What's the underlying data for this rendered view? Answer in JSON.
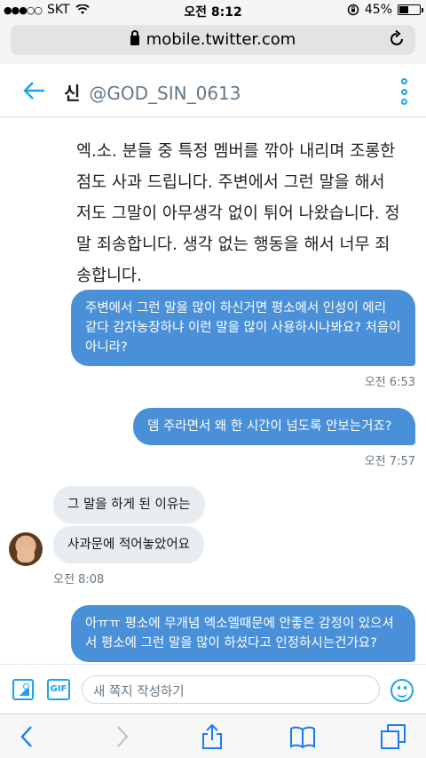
{
  "status_bar": {
    "signal_dots": "●●●○○",
    "carrier": "SKT",
    "time": "오전 8:12",
    "battery_percent": "45%",
    "battery_level": 0.45
  },
  "browser": {
    "url": "mobile.twitter.com"
  },
  "header": {
    "name": "신",
    "handle": "@GOD_SIN_0613",
    "accent": "#1da1f2"
  },
  "conversation": {
    "image_text": "엑.소. 분들 중 특정 멤버를 깎아 내리며 조롱한 점도 사과 드립니다. 주변에서 그런 말을 해서 저도 그말이 아무생각 없이 튀어 나왔습니다. 정말 죄송합니다. 생각 없는 행동을 해서 너무 죄송합니다.",
    "messages": [
      {
        "text": "주변에서 그런 말을 많이 하신거면 평소에서 인성이 에리 같다 감자농장하냐 이런 말을 많이 사용하시나봐요? 처음이 아니라?",
        "time": "오전 6:53"
      },
      {
        "text": "뎀 주라면서 왜 한 시간이 넘도록 안보는거죠?",
        "time": "오전 7:57"
      },
      {
        "text": "그 말을 하게 된 이유는"
      },
      {
        "text": "사과문에 적어놓았어요",
        "time": "오전 8:08"
      },
      {
        "text": "아ㅠㅠ 평소에 무개념 엑소엘때문에 안좋은 감정이 있으셔서 평소에 그런 말을 많이 하셨다고 인정하시는건가요?"
      }
    ]
  },
  "compose": {
    "placeholder": "새 쪽지 작성하기",
    "gif_label": "GIF"
  }
}
